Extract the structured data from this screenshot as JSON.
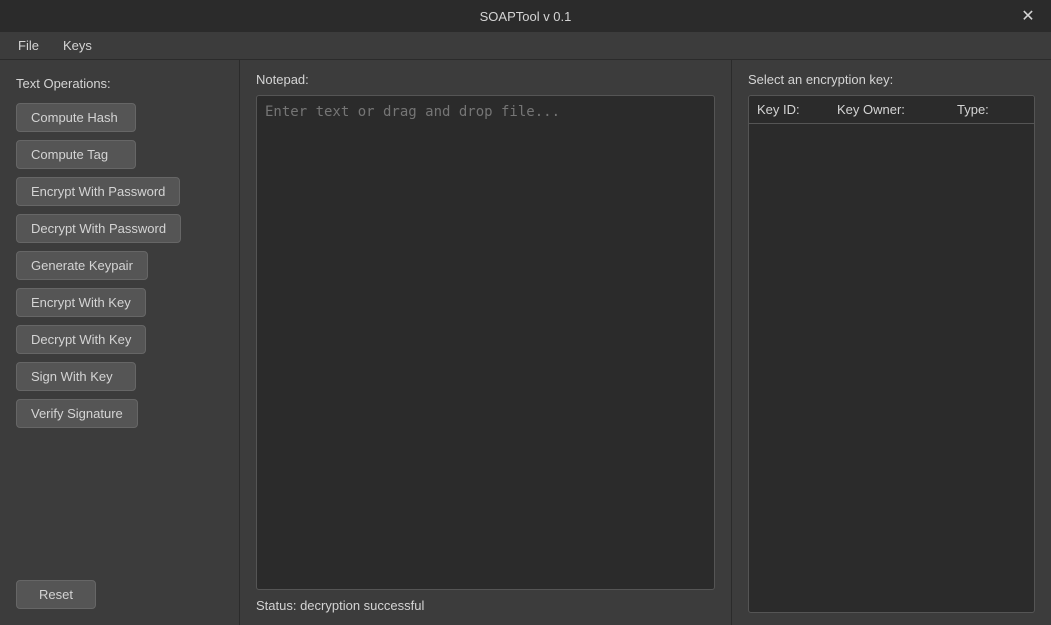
{
  "titleBar": {
    "title": "SOAPTool v 0.1",
    "closeLabel": "✕"
  },
  "menuBar": {
    "items": [
      {
        "id": "file",
        "label": "File"
      },
      {
        "id": "keys",
        "label": "Keys"
      }
    ]
  },
  "leftPanel": {
    "sectionLabel": "Text Operations:",
    "buttons": [
      {
        "id": "compute-hash",
        "label": "Compute Hash"
      },
      {
        "id": "compute-tag",
        "label": "Compute Tag"
      },
      {
        "id": "encrypt-with-password",
        "label": "Encrypt With Password"
      },
      {
        "id": "decrypt-with-password",
        "label": "Decrypt With Password"
      },
      {
        "id": "generate-keypair",
        "label": "Generate Keypair"
      },
      {
        "id": "encrypt-with-key",
        "label": "Encrypt With Key"
      },
      {
        "id": "decrypt-with-key",
        "label": "Decrypt With Key"
      },
      {
        "id": "sign-with-key",
        "label": "Sign With Key"
      },
      {
        "id": "verify-signature",
        "label": "Verify Signature"
      }
    ],
    "resetLabel": "Reset"
  },
  "centerPanel": {
    "notepadLabel": "Notepad:",
    "notepadPlaceholder": "Enter text or drag and drop file...",
    "statusText": "Status: decryption successful"
  },
  "rightPanel": {
    "keyLabel": "Select an encryption key:",
    "tableHeaders": {
      "keyId": "Key ID:",
      "keyOwner": "Key Owner:",
      "type": "Type:"
    }
  }
}
